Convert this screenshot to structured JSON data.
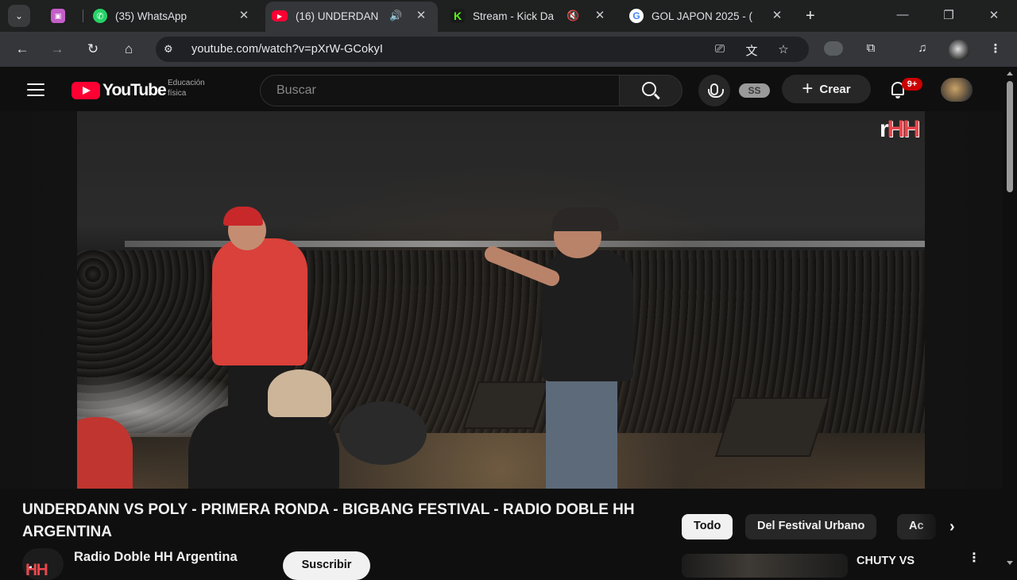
{
  "browser": {
    "tabs": [
      {
        "title": "",
        "favicon": "tab-group-icon"
      },
      {
        "title": "(35) WhatsApp",
        "favicon": "whatsapp-icon"
      },
      {
        "title": "(16) UNDERDAN",
        "favicon": "youtube-icon",
        "active": true,
        "audio": "speaker-icon"
      },
      {
        "title": "Stream - Kick Da",
        "favicon": "kick-icon",
        "audio": "muted-icon"
      },
      {
        "title": "GOL JAPON 2025 - (",
        "favicon": "google-icon"
      }
    ],
    "url": "youtube.com/watch?v=pXrW-GCokyI"
  },
  "youtube": {
    "logo_text": "YouTube",
    "logo_sub_line1": "Educación",
    "logo_sub_line2": "física",
    "search_placeholder": "Buscar",
    "ss_label": "SS",
    "create_label": "Crear",
    "notifications_badge": "9+"
  },
  "player": {
    "watermark_r": "r",
    "watermark_hh": "HH"
  },
  "video": {
    "title": "UNDERDANN VS POLY - PRIMERA RONDA - BIGBANG FESTIVAL - RADIO DOBLE HH ARGENTINA",
    "channel_name": "Radio Doble HH Argentina",
    "channel_logo_r": "r",
    "channel_logo_hh": "HH",
    "subscribe_label": "Suscribir"
  },
  "chips": [
    "Todo",
    "Del Festival Urbano",
    "Ac"
  ],
  "recommendations": [
    {
      "title": "CHUTY VS"
    }
  ],
  "colors": {
    "youtube_red": "#ff0033",
    "background": "#0f0f0f",
    "badge_red": "#cc0000"
  }
}
